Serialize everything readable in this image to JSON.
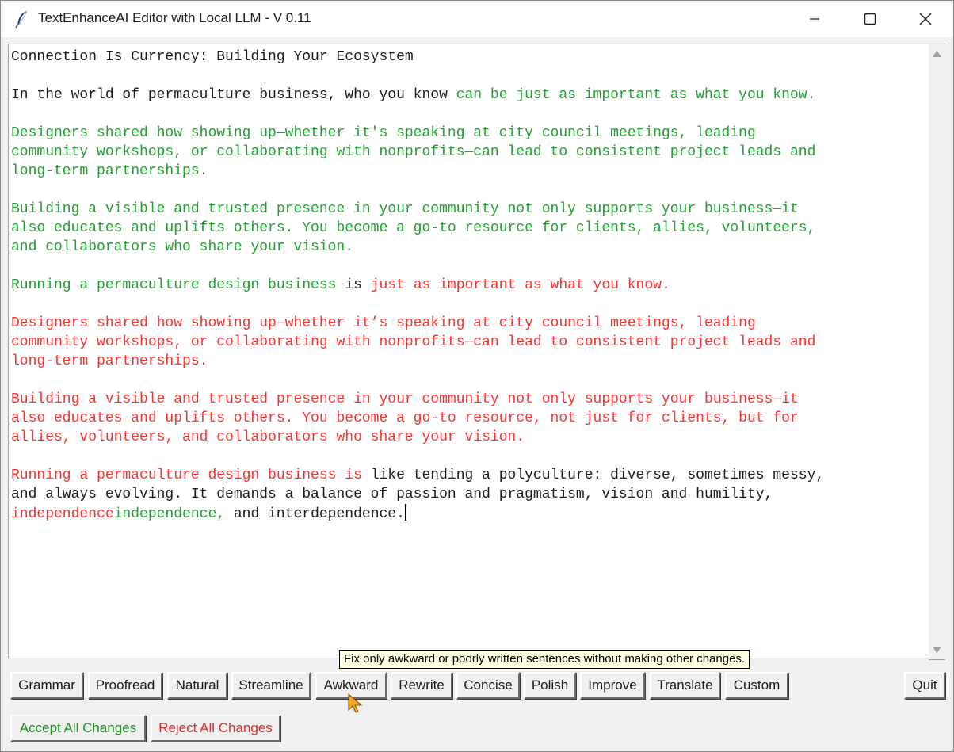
{
  "window": {
    "title": "TextEnhanceAI Editor with Local LLM - V 0.11"
  },
  "editor": {
    "lines": [
      [
        {
          "t": "Connection Is Currency: Building Your Ecosystem",
          "c": "k"
        }
      ],
      [],
      [
        {
          "t": "In the world of permaculture business, who you know ",
          "c": "k"
        },
        {
          "t": "can be just as important as what you know.",
          "c": "g"
        }
      ],
      [],
      [
        {
          "t": "Designers shared how showing up—whether it's speaking at city council meetings, leading",
          "c": "g"
        }
      ],
      [
        {
          "t": "community workshops, or collaborating with nonprofits—can lead to consistent project leads and",
          "c": "g"
        }
      ],
      [
        {
          "t": "long-term partnerships.",
          "c": "g"
        }
      ],
      [],
      [
        {
          "t": "Building a visible and trusted presence in your community not only supports your business—it",
          "c": "g"
        }
      ],
      [
        {
          "t": "also educates and uplifts others. You become a go-to resource for clients, allies, volunteers,",
          "c": "g"
        }
      ],
      [
        {
          "t": "and collaborators who share your vision.",
          "c": "g"
        }
      ],
      [],
      [
        {
          "t": "Running a permaculture design business",
          "c": "g"
        },
        {
          "t": " is ",
          "c": "k"
        },
        {
          "t": "just as important as what you know.",
          "c": "r"
        }
      ],
      [],
      [
        {
          "t": "Designers shared how showing up—whether it’s speaking at city council meetings, leading",
          "c": "r"
        }
      ],
      [
        {
          "t": "community workshops, or collaborating with nonprofits—can lead to consistent project leads and",
          "c": "r"
        }
      ],
      [
        {
          "t": "long-term partnerships.",
          "c": "r"
        }
      ],
      [],
      [
        {
          "t": "Building a visible and trusted presence in your community not only supports your business—it",
          "c": "r"
        }
      ],
      [
        {
          "t": "also educates and uplifts others. You become a go-to resource, not just for clients, but for",
          "c": "r"
        }
      ],
      [
        {
          "t": "allies, volunteers, and collaborators who share your vision.",
          "c": "r"
        }
      ],
      [],
      [
        {
          "t": "Running a permaculture design business is ",
          "c": "r"
        },
        {
          "t": "like tending a polyculture: diverse, sometimes messy,",
          "c": "k"
        }
      ],
      [
        {
          "t": "and always evolving. It demands a balance of passion and pragmatism, vision and humility,",
          "c": "k"
        }
      ],
      [
        {
          "t": "independence",
          "c": "r"
        },
        {
          "t": "independence,",
          "c": "g"
        },
        {
          "t": " and interdependence.",
          "c": "k"
        }
      ]
    ]
  },
  "toolbar": {
    "grammar": "Grammar",
    "proofread": "Proofread",
    "natural": "Natural",
    "streamline": "Streamline",
    "awkward": "Awkward",
    "rewrite": "Rewrite",
    "concise": "Concise",
    "polish": "Polish",
    "improve": "Improve",
    "translate": "Translate",
    "custom": "Custom",
    "quit": "Quit",
    "accept_all": "Accept All Changes",
    "reject_all": "Reject All Changes"
  },
  "tooltip": {
    "text": "Fix only awkward or poorly written sentences without making other changes."
  },
  "colors": {
    "added": "#22a032",
    "removed": "#ff3030"
  }
}
